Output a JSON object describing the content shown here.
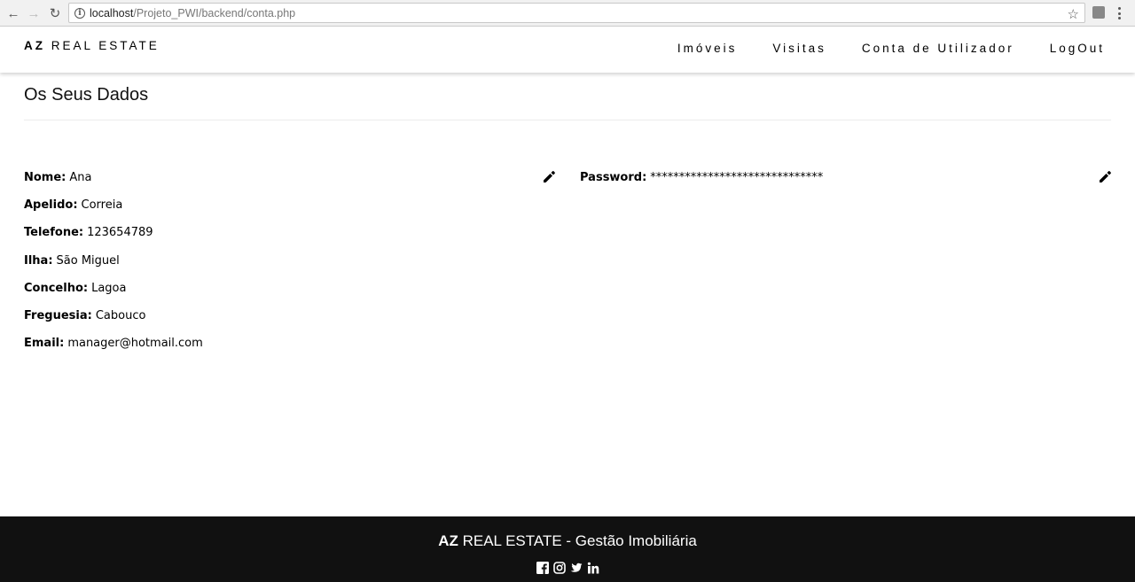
{
  "browser": {
    "url_host": "localhost",
    "url_path": "/Projeto_PWI/backend/conta.php"
  },
  "header": {
    "brand_bold": "AZ",
    "brand_rest": "REAL ESTATE",
    "nav": [
      "Imóveis",
      "Visitas",
      "Conta de Utilizador",
      "LogOut"
    ]
  },
  "main": {
    "title": "Os Seus Dados",
    "fields": [
      {
        "label": "Nome:",
        "value": "Ana"
      },
      {
        "label": "Apelido:",
        "value": "Correia"
      },
      {
        "label": "Telefone:",
        "value": "123654789"
      },
      {
        "label": "Ilha:",
        "value": "São Miguel"
      },
      {
        "label": "Concelho:",
        "value": "Lagoa"
      },
      {
        "label": "Freguesia:",
        "value": "Cabouco"
      },
      {
        "label": "Email:",
        "value": "manager@hotmail.com"
      }
    ],
    "password": {
      "label": "Password:",
      "value": "******************************"
    }
  },
  "footer": {
    "brand_bold": "AZ",
    "title_rest": "REAL ESTATE - Gestão Imobiliária",
    "social_icons": [
      "facebook-icon",
      "instagram-icon",
      "twitter-icon",
      "linkedin-icon"
    ]
  }
}
